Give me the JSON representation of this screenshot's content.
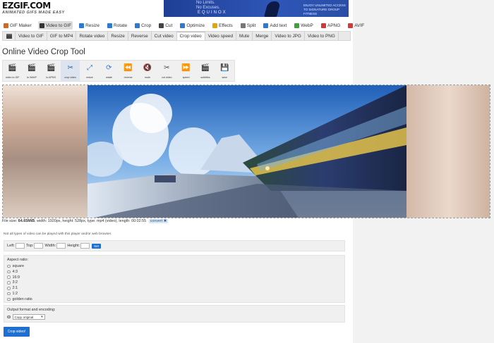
{
  "header": {
    "logo_main": "EZGIF.COM",
    "logo_tag": "ANIMATED GIFS MADE EASY",
    "ad": {
      "line1": "No Limits.",
      "line2": "No Excuses.",
      "brand": "EQUINOX",
      "side": "ENJOY UNLIMITED ACCESS TO SIGNATURE GROUP FITNESS"
    }
  },
  "main_nav": {
    "items": [
      {
        "label": "GIF Maker",
        "icon_color": "#d2691e"
      },
      {
        "label": "Video to GIF",
        "icon_color": "#333333",
        "active": true
      },
      {
        "label": "Resize",
        "icon_color": "#2b7bd6"
      },
      {
        "label": "Rotate",
        "icon_color": "#2b7bd6"
      },
      {
        "label": "Crop",
        "icon_color": "#2b7bd6"
      },
      {
        "label": "Cut",
        "icon_color": "#444444"
      },
      {
        "label": "Optimize",
        "icon_color": "#2b7bd6"
      },
      {
        "label": "Effects",
        "icon_color": "#e0a800"
      },
      {
        "label": "Split",
        "icon_color": "#777777"
      },
      {
        "label": "Add text",
        "icon_color": "#2b7bd6"
      },
      {
        "label": "WebP",
        "icon_color": "#3aa53a"
      },
      {
        "label": "APNG",
        "icon_color": "#d23a3a"
      },
      {
        "label": "AVIF",
        "icon_color": "#d23a3a"
      }
    ]
  },
  "sub_nav": {
    "tabs": [
      "Video to GIF",
      "GIF to MP4",
      "Rotate video",
      "Resize",
      "Reverse",
      "Cut video",
      "Crop video",
      "Video speed",
      "Mute",
      "Merge",
      "Video to JPG",
      "Video to PNG"
    ],
    "active": "Crop video"
  },
  "page_title": "Online Video Crop Tool",
  "tools": [
    {
      "label": "video to GIF",
      "glyph": "🎬"
    },
    {
      "label": "to WebP",
      "glyph": "🎬"
    },
    {
      "label": "to APNG",
      "glyph": "🎬"
    },
    {
      "label": "crop video",
      "glyph": "✂"
    },
    {
      "label": "resize",
      "glyph": "⤢"
    },
    {
      "label": "rotate",
      "glyph": "⟳"
    },
    {
      "label": "reverse",
      "glyph": "⏪"
    },
    {
      "label": "mute",
      "glyph": "🔇"
    },
    {
      "label": "cut video",
      "glyph": "✂"
    },
    {
      "label": "speed",
      "glyph": "⏩"
    },
    {
      "label": "subtitles",
      "glyph": "🎬"
    },
    {
      "label": "save",
      "glyph": "💾"
    }
  ],
  "file_info": {
    "label": "File size:",
    "size": "64.65MiB",
    "rest": ", width: 1920px, height: 528px, type: mp4 (video), length: 00:02:55",
    "convert": "convert ✖"
  },
  "note": "Not all types of video can be played with this player and/or web browser.",
  "crop": {
    "left": "Left:",
    "top": "Top:",
    "width": "Width:",
    "height": "Height:",
    "set": "Set"
  },
  "aspect": {
    "heading": "Aspect ratio:",
    "options": [
      "square",
      "4:3",
      "16:9",
      "3:2",
      "2:1",
      "1:2",
      "golden ratio"
    ]
  },
  "output": {
    "heading": "Output format and encoding:",
    "selected": "Copy original"
  },
  "crop_button": "Crop video!"
}
